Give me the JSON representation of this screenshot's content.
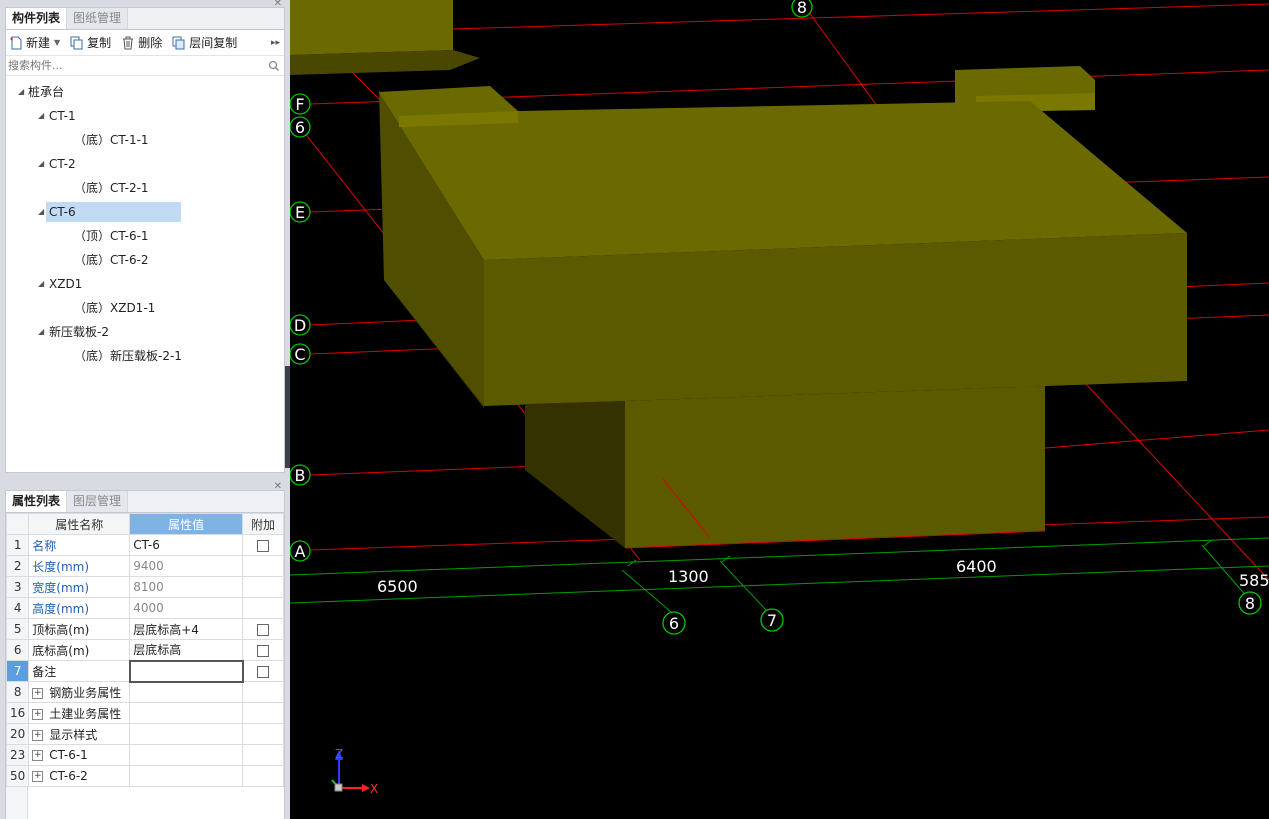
{
  "component_panel": {
    "tabs": [
      "构件列表",
      "图纸管理"
    ],
    "toolbar": {
      "new_label": "新建",
      "copy_label": "复制",
      "delete_label": "删除",
      "floor_copy_label": "层间复制"
    },
    "search_placeholder": "搜索构件...",
    "tree": {
      "root": "桩承台",
      "groups": [
        {
          "name": "CT-1",
          "children": [
            "（底）CT-1-1"
          ]
        },
        {
          "name": "CT-2",
          "children": [
            "（底）CT-2-1"
          ]
        },
        {
          "name": "CT-6",
          "children": [
            "（顶）CT-6-1",
            "（底）CT-6-2"
          ],
          "selected": true
        },
        {
          "name": "XZD1",
          "children": [
            "（底）XZD1-1"
          ]
        },
        {
          "name": "新压载板-2",
          "children": [
            "（底）新压载板-2-1"
          ]
        }
      ]
    }
  },
  "property_panel": {
    "tabs": [
      "属性列表",
      "图层管理"
    ],
    "headers": {
      "name": "属性名称",
      "value": "属性值",
      "extra": "附加"
    },
    "rows": [
      {
        "num": "1",
        "name": "名称",
        "value": "CT-6",
        "check": true
      },
      {
        "num": "2",
        "name": "长度(mm)",
        "value": "9400",
        "check": false
      },
      {
        "num": "3",
        "name": "宽度(mm)",
        "value": "8100",
        "check": false
      },
      {
        "num": "4",
        "name": "高度(mm)",
        "value": "4000",
        "check": false
      },
      {
        "num": "5",
        "name": "顶标高(m)",
        "value": "层底标高+4",
        "check": true
      },
      {
        "num": "6",
        "name": "底标高(m)",
        "value": "层底标高",
        "check": true
      },
      {
        "num": "7",
        "name": "备注",
        "value": "",
        "check": true
      }
    ],
    "groups": [
      {
        "num": "8",
        "name": "钢筋业务属性"
      },
      {
        "num": "16",
        "name": "土建业务属性"
      },
      {
        "num": "20",
        "name": "显示样式"
      },
      {
        "num": "23",
        "name": "CT-6-1"
      },
      {
        "num": "50",
        "name": "CT-6-2"
      }
    ]
  },
  "viewport": {
    "axis_labels": {
      "a": "A",
      "b": "B",
      "c": "C",
      "d": "D",
      "e": "E",
      "f": "F",
      "g6_left": "6",
      "g6": "6",
      "g7": "7",
      "g8_top": "8",
      "g8": "8"
    },
    "dimensions": {
      "d1": "6500",
      "d2": "1300",
      "d3": "6400",
      "d4": "585"
    },
    "gizmo": {
      "z": "Z",
      "x": "X"
    },
    "colors": {
      "background": "#000000",
      "solid_top": "#6b6a00",
      "solid_front": "#5c5a00",
      "solid_side": "#3e3c00",
      "axis_line": "#e00000",
      "dim_line": "#00a000",
      "bubble": "#00c800"
    }
  }
}
